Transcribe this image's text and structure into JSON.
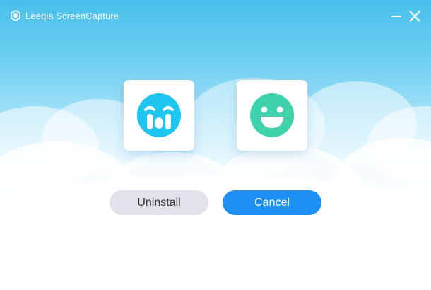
{
  "window": {
    "title": "Leeqia ScreenCapture",
    "app_icon": "leeqia-logo-icon",
    "minimize_icon": "minimize-icon",
    "close_icon": "close-icon"
  },
  "illustration": {
    "left_icon": "crying-face-icon",
    "right_icon": "smiling-face-icon"
  },
  "actions": {
    "uninstall_label": "Uninstall",
    "cancel_label": "Cancel"
  },
  "colors": {
    "sky_top": "#47c0ec",
    "crying_face": "#1ec5ef",
    "smiling_face": "#3fd3ad",
    "cancel_button": "#1e90f4",
    "uninstall_button": "#e2e2ea"
  }
}
